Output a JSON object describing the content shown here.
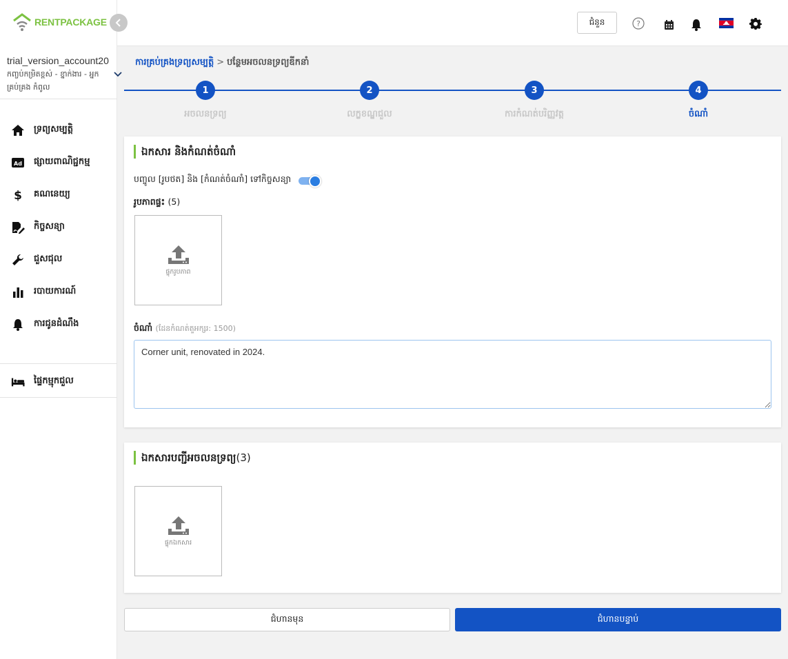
{
  "brand": {
    "part1": "RENT",
    "part2": "PACKAGE",
    "color": "#7cc242"
  },
  "account": {
    "name": "trial_version_account20",
    "role": "កញ្ចប់កម្រិតខ្ពស់ - ខ្នាក់ងារ - អ្នកគ្រប់គ្រង កំពូល"
  },
  "sidebar": {
    "items": [
      {
        "icon": "home-icon",
        "label": "ទ្រព្យសម្បត្តិ"
      },
      {
        "icon": "ad-icon",
        "label": "ផ្សាយពាណិជ្ជកម្ម"
      },
      {
        "icon": "dollar-icon",
        "label": "គណនេយ្យ"
      },
      {
        "icon": "contract-icon",
        "label": "កិច្ចសន្យា"
      },
      {
        "icon": "wrench-icon",
        "label": "ជួសជុល"
      },
      {
        "icon": "bar-chart-icon",
        "label": "របាយការណ៍"
      },
      {
        "icon": "bell-icon",
        "label": "ការជូនដំណឹង"
      }
    ],
    "bottom_item": {
      "icon": "bed-icon",
      "label": "ផ្ទៃកម្មុកជួល"
    }
  },
  "header": {
    "button_label": "ជំនួន",
    "icons": [
      "help-icon",
      "calendar-icon",
      "notification-bell-icon",
      "cambodia-flag-icon",
      "settings-gear-icon"
    ]
  },
  "breadcrumb": {
    "parent": "ការគ្រប់គ្រងទ្រព្យសម្បត្តិ",
    "separator": ">",
    "current": "បន្ថែមអចលនទ្រព្យឌីកនាំ"
  },
  "stepper": {
    "steps": [
      {
        "number": "1",
        "label": "អចលនទ្រព្យ"
      },
      {
        "number": "2",
        "label": "លក្ខខណ្ឌជួល"
      },
      {
        "number": "3",
        "label": "ការកំណត់បរិញ្ញវត្ត"
      },
      {
        "number": "4",
        "label": "ចំណាំ"
      }
    ],
    "active_index": 3,
    "color": "#1353c4"
  },
  "notes_card": {
    "title": "ឯកសារ និងកំណត់ចំណាំ",
    "toggle_label": "បញ្ចូល [រូបថត] និង [កំណត់ចំណាំ] ទៅកិច្ចសន្យា",
    "toggle_on": true,
    "photos_label": "រូបភាពផ្ទះ",
    "photos_count": "(5)",
    "upload_photo_label": "ផ្ទុករូបភាព",
    "note_label": "ចំណាំ",
    "note_hint": "(ដែនកំណត់តួអក្សរ: 1500)",
    "note_value": "Corner unit, renovated in 2024."
  },
  "docs_card": {
    "title": "ឯកសារបញ្ជីអចលនទ្រព្យ",
    "count": "(3)",
    "upload_doc_label": "ផ្ទុកឯកសារ"
  },
  "buttons": {
    "prev": "ជំហានមុន",
    "next": "ជំហានបន្ទាប់"
  }
}
